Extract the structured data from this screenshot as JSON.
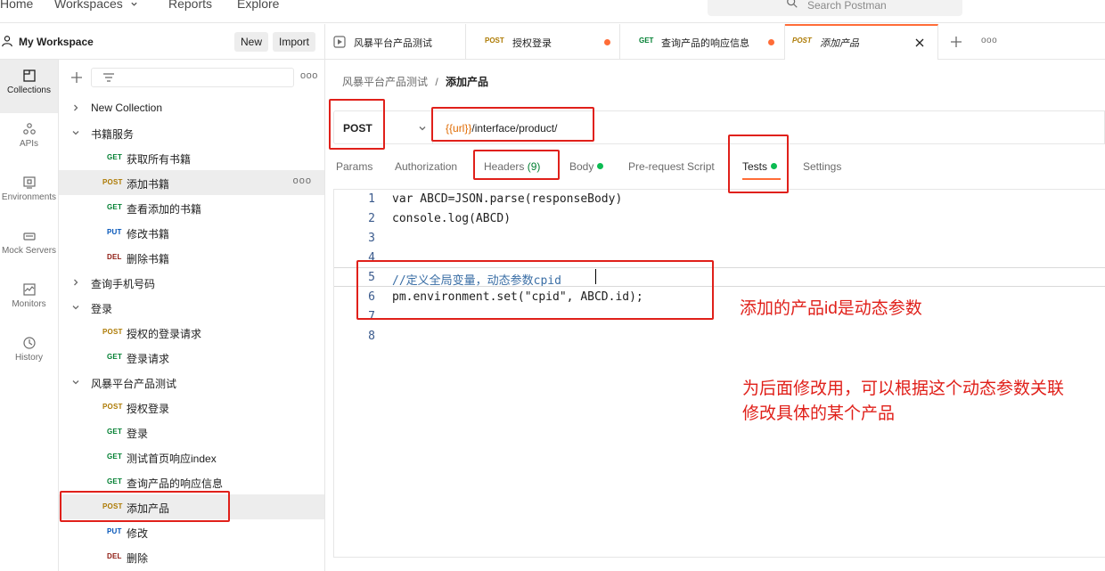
{
  "topnav": {
    "items": [
      "Home",
      "Workspaces",
      "Reports",
      "Explore"
    ],
    "search_placeholder": "Search Postman"
  },
  "workspace": {
    "name": "My Workspace",
    "new_label": "New",
    "import_label": "Import"
  },
  "rail": [
    {
      "label": "Collections",
      "icon": "collections-icon"
    },
    {
      "label": "APIs",
      "icon": "apis-icon"
    },
    {
      "label": "Environments",
      "icon": "environments-icon"
    },
    {
      "label": "Mock Servers",
      "icon": "mock-servers-icon"
    },
    {
      "label": "Monitors",
      "icon": "monitors-icon"
    },
    {
      "label": "History",
      "icon": "history-icon"
    }
  ],
  "sidebar": {
    "more": "ooo",
    "tree": [
      {
        "label": "New Collection"
      },
      {
        "label": "书籍服务"
      },
      {
        "method": "GET",
        "label": "获取所有书籍"
      },
      {
        "method": "POST",
        "label": "添加书籍"
      },
      {
        "method": "GET",
        "label": "查看添加的书籍"
      },
      {
        "method": "PUT",
        "label": "修改书籍"
      },
      {
        "method": "DEL",
        "label": "删除书籍"
      },
      {
        "label": "查询手机号码"
      },
      {
        "label": "登录"
      },
      {
        "method": "POST",
        "label": "授权的登录请求"
      },
      {
        "method": "GET",
        "label": "登录请求"
      },
      {
        "label": "风暴平台产品测试"
      },
      {
        "method": "POST",
        "label": "授权登录"
      },
      {
        "method": "GET",
        "label": "登录"
      },
      {
        "method": "GET",
        "label": "测试首页响应index"
      },
      {
        "method": "GET",
        "label": "查询产品的响应信息"
      },
      {
        "method": "POST",
        "label": "添加产品"
      },
      {
        "method": "PUT",
        "label": "修改"
      },
      {
        "method": "DEL",
        "label": "删除"
      }
    ]
  },
  "tabs": [
    {
      "label": "风暴平台产品测试"
    },
    {
      "method": "POST",
      "label": "授权登录"
    },
    {
      "method": "GET",
      "label": "查询产品的响应信息"
    },
    {
      "method": "POST",
      "label": "添加产品"
    }
  ],
  "tabbar_more": "ooo",
  "breadcrumb": {
    "parent": "风暴平台产品测试",
    "sep": "/",
    "current": "添加产品"
  },
  "request": {
    "method": "POST",
    "url_var": "{{url}}",
    "url_path": "/interface/product/"
  },
  "req_tabs": {
    "params": "Params",
    "authorization": "Authorization",
    "headers": "Headers",
    "headers_count": "(9)",
    "body": "Body",
    "prerequest": "Pre-request Script",
    "tests": "Tests",
    "settings": "Settings"
  },
  "code_lines": [
    "var ABCD=JSON.parse(responseBody)",
    "console.log(ABCD)",
    "",
    "",
    "//定义全局变量，动态参数cpid",
    "pm.environment.set(\"cpid\", ABCD.id);",
    "",
    ""
  ],
  "line_numbers": [
    "1",
    "2",
    "3",
    "4",
    "5",
    "6",
    "7",
    "8"
  ],
  "annotations": {
    "note1": "添加的产品id是动态参数",
    "note2_line1": "为后面修改用，可以根据这个动态参数关联",
    "note2_line2": "修改具体的某个产品"
  },
  "colors": {
    "accent": "#ff6c37",
    "annotation": "#e0201a",
    "get": "#007f31",
    "post": "#ad7a03",
    "put": "#0053b8",
    "del": "#8e1a10"
  }
}
